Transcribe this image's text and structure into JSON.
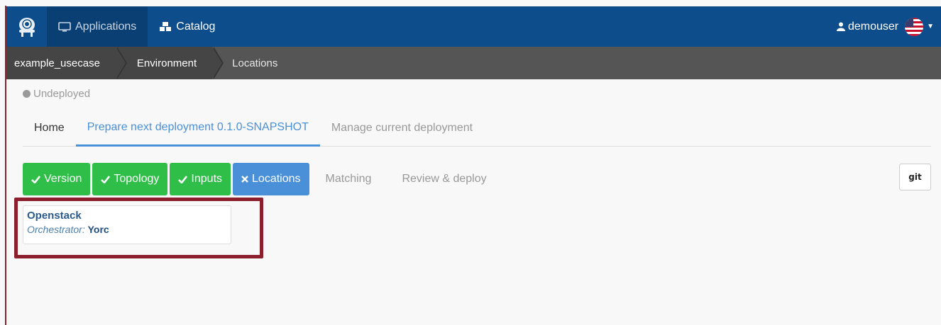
{
  "navbar": {
    "applications_label": "Applications",
    "catalog_label": "Catalog",
    "username": "demouser"
  },
  "breadcrumb": {
    "items": [
      "example_usecase",
      "Environment",
      "Locations"
    ]
  },
  "status": {
    "label": "Undeployed",
    "color": "#999999"
  },
  "tabs": [
    {
      "label": "Home"
    },
    {
      "label": "Prepare next deployment 0.1.0-SNAPSHOT"
    },
    {
      "label": "Manage current deployment"
    }
  ],
  "steps": [
    {
      "label": "Version",
      "state": "done",
      "icon": "check-icon"
    },
    {
      "label": "Topology",
      "state": "done",
      "icon": "check-icon"
    },
    {
      "label": "Inputs",
      "state": "done",
      "icon": "check-icon"
    },
    {
      "label": "Locations",
      "state": "current",
      "icon": "times-icon"
    },
    {
      "label": "Matching",
      "state": "pending"
    },
    {
      "label": "Review & deploy",
      "state": "pending"
    }
  ],
  "git_button_label": "git",
  "location": {
    "name": "Openstack",
    "orchestrator_label": "Orchestrator",
    "orchestrator_value": "Yorc"
  },
  "colors": {
    "navbar": "#0d4d8c",
    "step_done": "#2fbf49",
    "step_current": "#4a90d9",
    "highlight": "#8b1f2e"
  }
}
